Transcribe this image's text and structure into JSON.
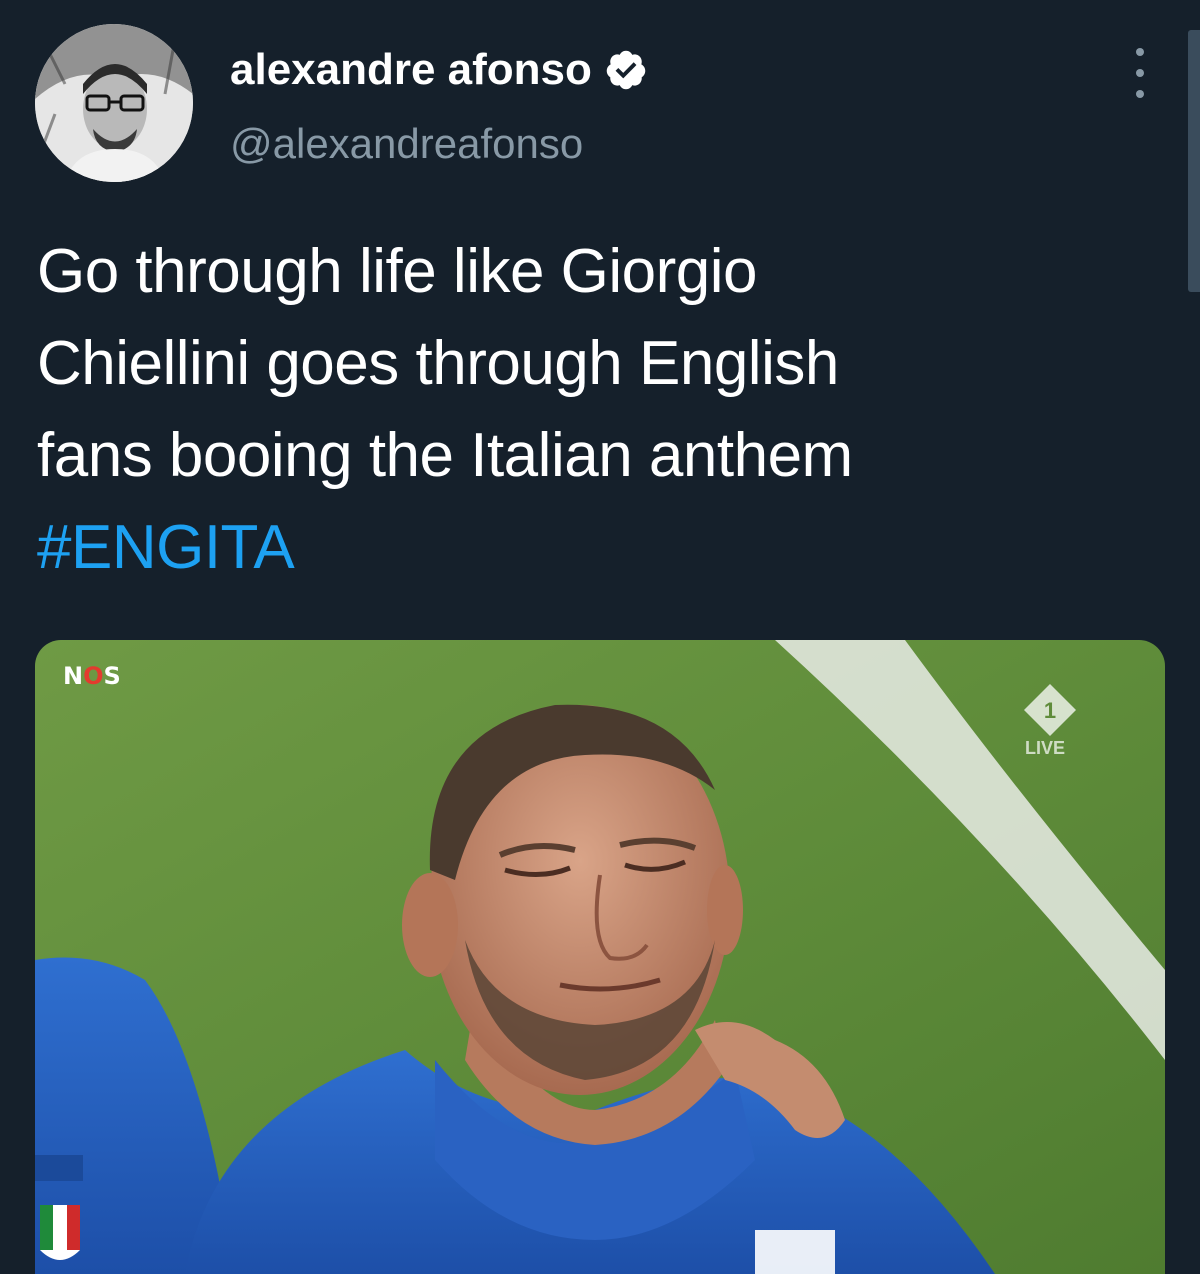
{
  "tweet": {
    "author": {
      "name": "alexandre afonso",
      "handle": "@alexandreafonso",
      "verified": true
    },
    "text_lines": [
      "Go through life like Giorgio",
      "Chiellini goes through English",
      "fans booing the Italian anthem"
    ],
    "hashtag": "#ENGITA",
    "media": {
      "broadcaster_logo": "NOS",
      "channel_live_label": "LIVE",
      "icons": [
        "verified-badge-icon",
        "more-options-icon",
        "nos-logo",
        "npo1-logo"
      ]
    }
  },
  "colors": {
    "background": "#15202b",
    "text": "#ffffff",
    "secondary_text": "#8899a6",
    "link": "#1da1f2"
  }
}
